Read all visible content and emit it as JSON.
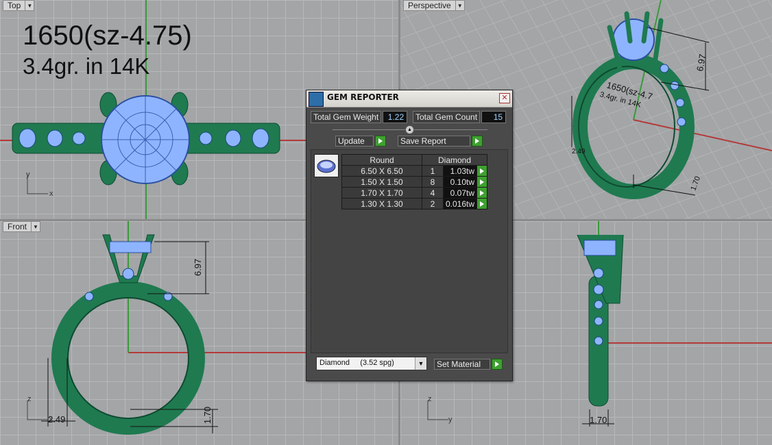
{
  "viewports": {
    "top": {
      "label": "Top",
      "title_line1": "1650(sz-4.75)",
      "title_line2": "3.4gr.  in 14K",
      "axis_x": "x",
      "axis_y": "y"
    },
    "perspective": {
      "label": "Perspective",
      "dim_height": "6.97",
      "dim_shank": "2.49",
      "dim_width": "1.70",
      "engraving_line1": "1650(sz-4.7",
      "engraving_line2": "3.4gr.  in 14K"
    },
    "front": {
      "label": "Front",
      "dim_height": "6.97",
      "dim_shank": "2.49",
      "dim_width": "1.70",
      "axis_x": "x",
      "axis_z": "z"
    },
    "right": {
      "dim_width": "1.70",
      "axis_y": "y",
      "axis_z": "z"
    }
  },
  "dialog": {
    "title": "GEM REPORTER",
    "total_weight_label": "Total Gem Weight",
    "total_weight_value": "1.22",
    "total_count_label": "Total Gem Count",
    "total_count_value": "15",
    "update_label": "Update",
    "save_report_label": "Save Report",
    "table": {
      "headers": [
        "Round",
        "Diamond"
      ],
      "rows": [
        {
          "size": "6.50 X 6.50",
          "count": "1",
          "weight": "1.03tw"
        },
        {
          "size": "1.50 X 1.50",
          "count": "8",
          "weight": "0.10tw"
        },
        {
          "size": "1.70 X 1.70",
          "count": "4",
          "weight": "0.07tw"
        },
        {
          "size": "1.30 X 1.30",
          "count": "2",
          "weight": "0.016tw"
        }
      ]
    },
    "material_select": "Diamond     (3.52 spg)",
    "set_material_label": "Set Material"
  },
  "colors": {
    "metal": "#1f7a50",
    "gem": "#8fb4ff",
    "axis_x": "#b43a3a",
    "axis_y": "#3a9a3a",
    "accent_button": "#3ea030"
  }
}
